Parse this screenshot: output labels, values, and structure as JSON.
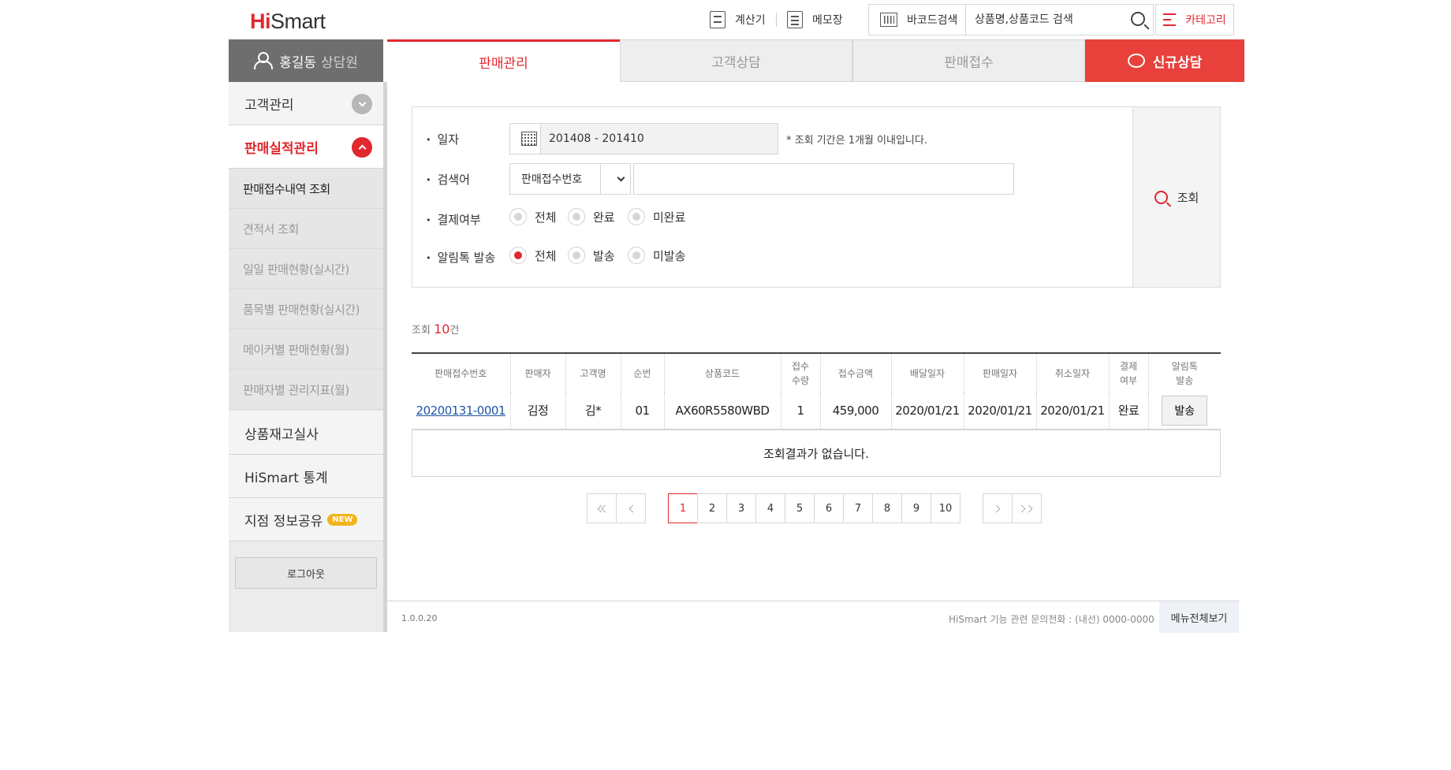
{
  "header": {
    "logo_hi": "Hi",
    "logo_smart": "Smart",
    "calculator_label": "계산기",
    "memo_label": "메모장",
    "barcode_label": "바코드검색",
    "search_placeholder": "상품명,상품코드 검색",
    "category_label": "카테고리"
  },
  "sidebar": {
    "agent_name": "홍길동",
    "agent_role": "상담원",
    "menu_customer": "고객관리",
    "menu_sales": "판매실적관리",
    "sub_items": [
      "판매접수내역 조회",
      "견적서 조회",
      "일일 판매현황(실시간)",
      "품목별 판매현황(실시간)",
      "메이커별 판매현황(월)",
      "판매자별 관리지표(월)"
    ],
    "menu_inventory": "상품재고실사",
    "menu_stats": "HiSmart 통계",
    "menu_share": "지점 정보공유",
    "new_badge": "NEW",
    "logout": "로그아웃"
  },
  "tabs": [
    "판매관리",
    "고객상담",
    "판매접수",
    "신규상담"
  ],
  "form": {
    "date_label": "일자",
    "date_value": "201408 - 201410",
    "date_note": "* 조회 기간은 1개월 이내입니다.",
    "keyword_label": "검색어",
    "keyword_select": "판매접수번호",
    "keyword_value": "",
    "payment_label": "결제여부",
    "payment_options": [
      "전체",
      "완료",
      "미완료"
    ],
    "payment_selected": "",
    "alimtalk_label": "알림톡 발송",
    "alimtalk_options": [
      "전체",
      "발송",
      "미발송"
    ],
    "alimtalk_selected": "전체",
    "search_button": "조회"
  },
  "results": {
    "count_prefix": "조회",
    "count_value": "10",
    "count_suffix": "건",
    "columns": [
      "판매접수번호",
      "판매자",
      "고객명",
      "순번",
      "상품코드",
      "접수\n수량",
      "접수금액",
      "배달일자",
      "판매일자",
      "취소일자",
      "결제\n여부",
      "알림톡\n발송"
    ],
    "rows": [
      {
        "receipt_no": "20200131-0001",
        "seller": "김정",
        "customer": "김*",
        "seq": "01",
        "product_code": "AX60R5580WBD",
        "qty": "1",
        "amount": "459,000",
        "delivery_date": "2020/01/21",
        "sale_date": "2020/01/21",
        "cancel_date": "2020/01/21",
        "paid": "완료",
        "send_label": "발송"
      }
    ],
    "empty_message": "조회결과가 없습니다."
  },
  "pagination": {
    "pages": [
      "1",
      "2",
      "3",
      "4",
      "5",
      "6",
      "7",
      "8",
      "9",
      "10"
    ],
    "current": "1"
  },
  "footer": {
    "version": "1.0.0.20",
    "contact": "HiSmart 기능 관련 문의전화 : (내선) 0000-0000",
    "all_menu": "메뉴전체보기"
  },
  "colors": {
    "accent": "#e0282e",
    "cta": "#e8413b",
    "link": "#1f55a6"
  }
}
